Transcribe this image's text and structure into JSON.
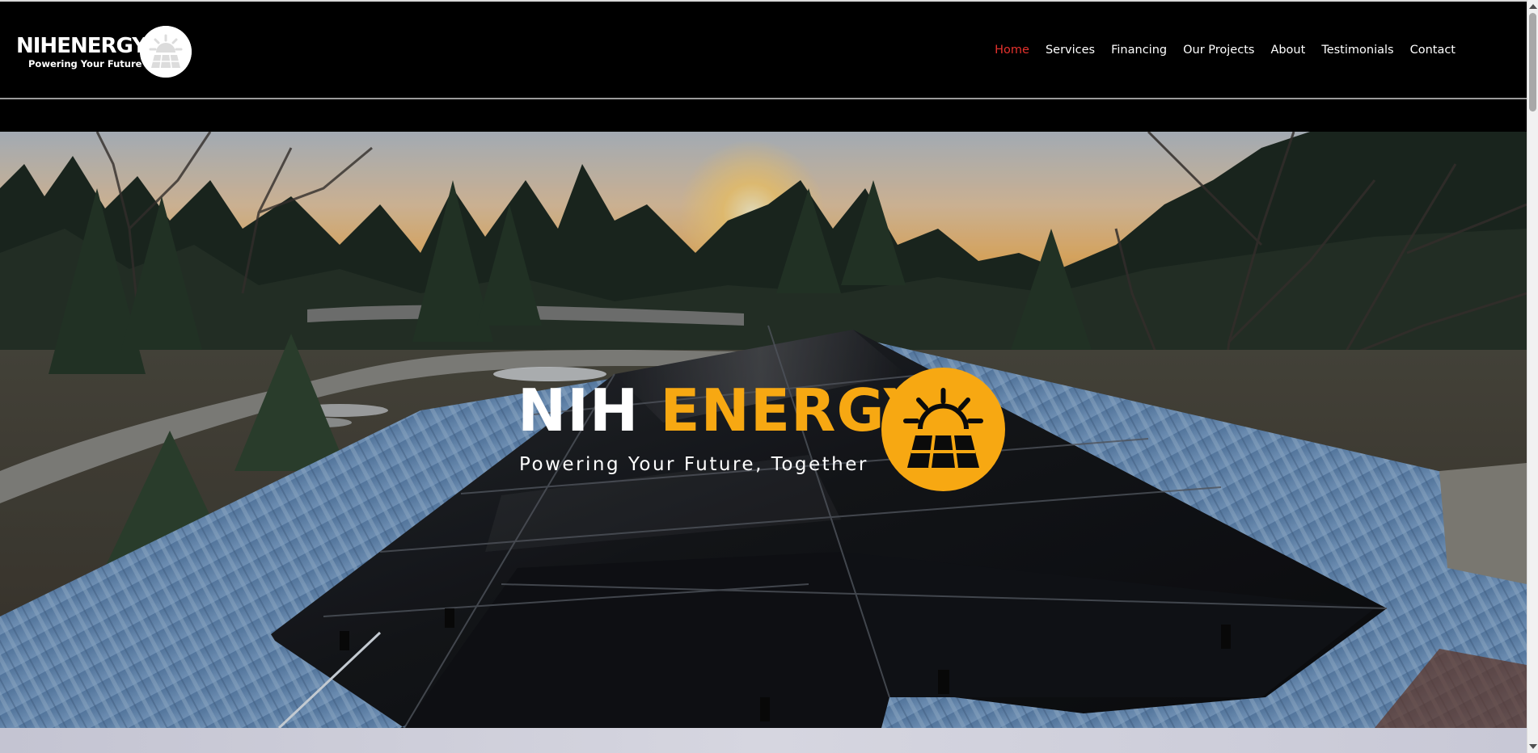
{
  "header": {
    "logo": {
      "wordmark": "NIHENERGY",
      "tagline": "Powering Your Future",
      "badge_icon": "sun-solar-panel-icon"
    },
    "nav": [
      {
        "label": "Home",
        "active": true
      },
      {
        "label": "Services",
        "active": false
      },
      {
        "label": "Financing",
        "active": false
      },
      {
        "label": "Our Projects",
        "active": false
      },
      {
        "label": "About",
        "active": false
      },
      {
        "label": "Testimonials",
        "active": false
      },
      {
        "label": "Contact",
        "active": false
      }
    ]
  },
  "hero": {
    "title_part1": "NIH",
    "title_part2": "ENERGY",
    "subtitle": "Powering Your Future, Together",
    "badge_icon": "sun-solar-panel-icon",
    "background": "rooftop-solar-panels-at-sunset-photo"
  },
  "colors": {
    "header_background": "#000000",
    "nav_text": "#ffffff",
    "nav_active": "#e5322d",
    "brand_orange": "#f7a812",
    "badge_white": "#ffffff"
  }
}
